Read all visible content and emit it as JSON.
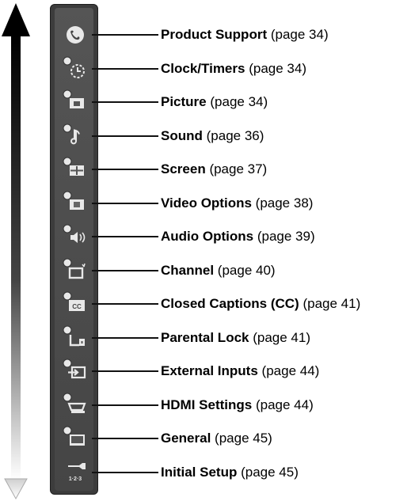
{
  "menu": {
    "items": [
      {
        "name": "Product Support",
        "page": "(page 34)",
        "icon": "product-support-icon"
      },
      {
        "name": "Clock/Timers",
        "page": "(page 34)",
        "icon": "clock-timers-icon"
      },
      {
        "name": "Picture",
        "page": "(page 34)",
        "icon": "picture-icon"
      },
      {
        "name": "Sound",
        "page": "(page 36)",
        "icon": "sound-icon"
      },
      {
        "name": "Screen",
        "page": "(page 37)",
        "icon": "screen-icon"
      },
      {
        "name": "Video Options",
        "page": "(page 38)",
        "icon": "video-options-icon"
      },
      {
        "name": "Audio Options",
        "page": "(page 39)",
        "icon": "audio-options-icon"
      },
      {
        "name": "Channel",
        "page": "(page 40)",
        "icon": "channel-icon"
      },
      {
        "name": "Closed Captions (CC)",
        "page": "(page 41)",
        "icon": "closed-captions-icon"
      },
      {
        "name": "Parental Lock",
        "page": "(page 41)",
        "icon": "parental-lock-icon"
      },
      {
        "name": "External Inputs",
        "page": "(page 44)",
        "icon": "external-inputs-icon"
      },
      {
        "name": "HDMI Settings",
        "page": "(page 44)",
        "icon": "hdmi-settings-icon"
      },
      {
        "name": "General",
        "page": "(page 45)",
        "icon": "general-icon"
      },
      {
        "name": "Initial Setup",
        "page": "(page 45)",
        "icon": "initial-setup-icon"
      }
    ],
    "icon_texts": {
      "cc": "CC",
      "setup": "1·2·3"
    }
  },
  "colors": {
    "bar": "#3c3c3c",
    "icon": "#e8e8e8",
    "arrow_top": "#000000",
    "arrow_bottom": "#ffffff"
  }
}
